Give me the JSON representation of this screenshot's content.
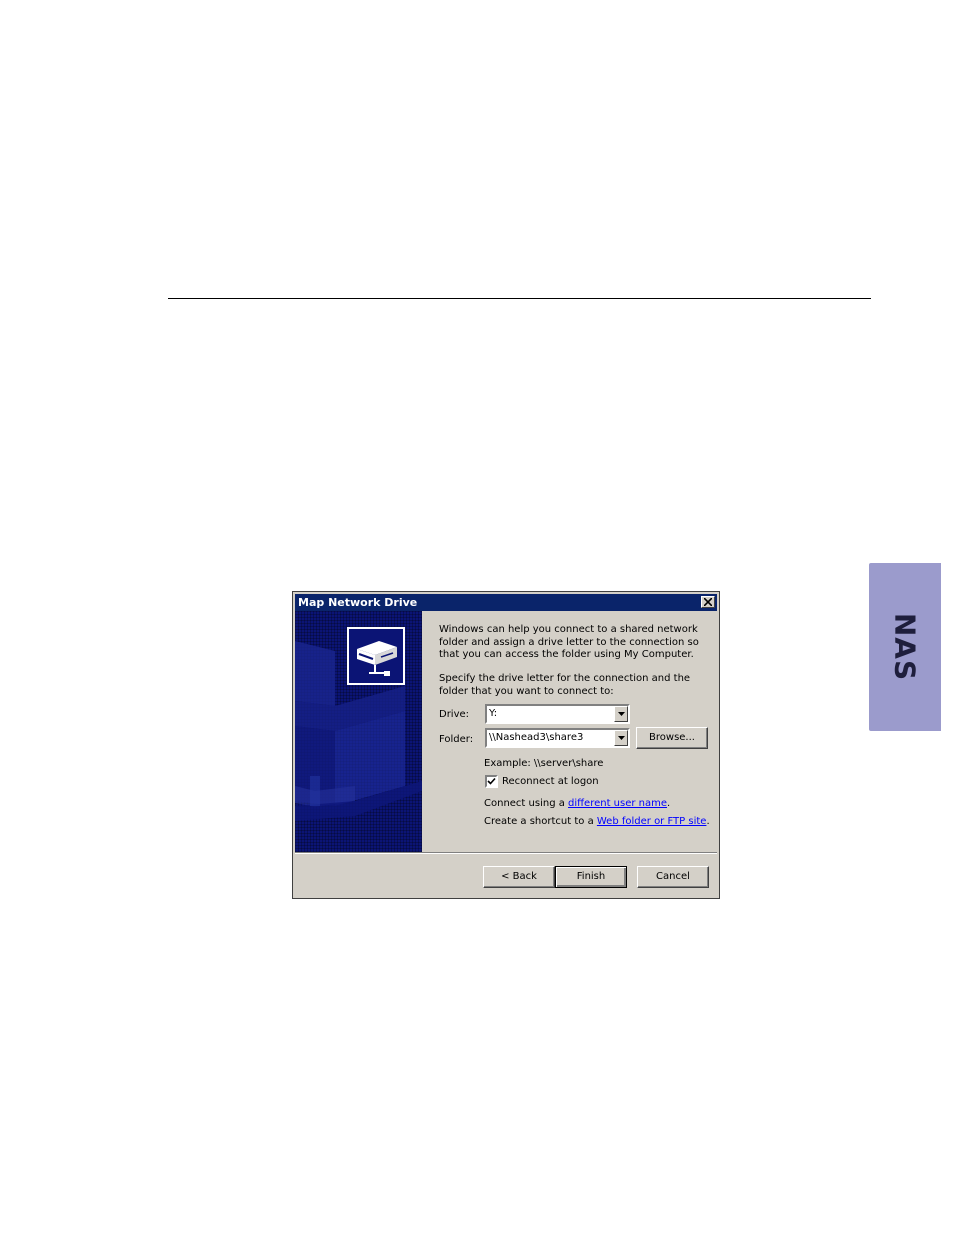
{
  "side_tab": {
    "label": "NAS"
  },
  "dialog": {
    "title": "Map Network Drive",
    "intro": "Windows can help you connect to a shared network folder and assign a drive letter to the connection so that you can access the folder using My Computer.",
    "instruction": "Specify the drive letter for the connection and the folder that you want to connect to:",
    "drive": {
      "label": "Drive:",
      "value": "Y:"
    },
    "folder": {
      "label": "Folder:",
      "value": "\\\\Nashead3\\share3"
    },
    "browse_button": "Browse...",
    "example": "Example: \\\\server\\share",
    "reconnect": {
      "label": "Reconnect at logon",
      "checked": true
    },
    "connect_using": {
      "prefix": "Connect using a ",
      "link": "different user name",
      "suffix": "."
    },
    "shortcut": {
      "prefix": "Create a shortcut to a ",
      "link": "Web folder or FTP site",
      "suffix": "."
    },
    "buttons": {
      "back": "< Back",
      "finish": "Finish",
      "cancel": "Cancel"
    }
  }
}
